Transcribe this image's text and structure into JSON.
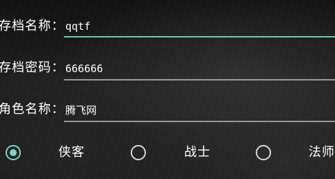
{
  "form": {
    "save_name": {
      "label": "存档名称：",
      "value": "qqtf"
    },
    "save_password": {
      "label": "存档密码：",
      "value": "666666"
    },
    "character_name": {
      "label": "角色名称：",
      "value": "腾飞网"
    }
  },
  "role_options": [
    {
      "label": "侠客",
      "selected": true
    },
    {
      "label": "战士",
      "selected": false
    },
    {
      "label": "法师",
      "selected": false
    }
  ],
  "colors": {
    "accent": "#66c9b6",
    "underline": "#9a9a9a",
    "text": "#ffffff"
  }
}
